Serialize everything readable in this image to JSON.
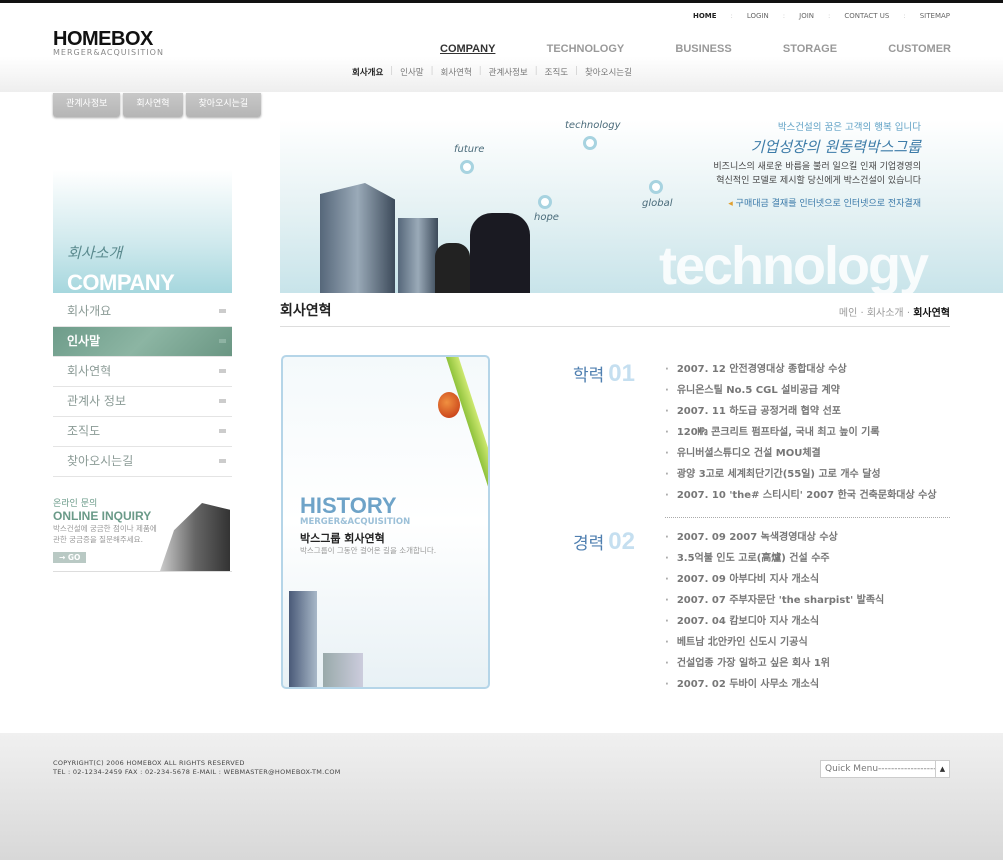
{
  "logo": {
    "title": "HOMEBOX",
    "subtitle": "MERGER&ACQUISITION"
  },
  "util_nav": [
    "HOME",
    "LOGIN",
    "JOIN",
    "CONTACT US",
    "SITEMAP"
  ],
  "main_nav": [
    "COMPANY",
    "TECHNOLOGY",
    "BUSINESS",
    "STORAGE",
    "CUSTOMER"
  ],
  "sub_nav": [
    "회사개요",
    "인사말",
    "회사연혁",
    "관계사정보",
    "조직도",
    "찾아오시는길"
  ],
  "tabs": [
    "관계사정보",
    "회사연혁",
    "찾아오시는길"
  ],
  "banner": {
    "nodes": [
      "future",
      "technology",
      "hope",
      "global"
    ],
    "line1": "박스건설의 꿈은 고객의 행복 입니다",
    "line2": "기업성장의 원동력박스그룹",
    "line3": "비즈니스의 새로운 바름을 불러 일으킬 인재 기업경영의",
    "line4": "혁신적인 모델로 제시할 당신에게 박스건설이 있습니다",
    "link": "구매대금 결재를 인터넷으로 인터넷으로 전자결재",
    "big_word": "technology"
  },
  "left_banner": {
    "korean": "회사소개",
    "english": "COMPANY"
  },
  "left_menu": [
    "회사개요",
    "인사말",
    "회사연혁",
    "관계사 정보",
    "조직도",
    "찾아오시는길"
  ],
  "active_menu_index": 1,
  "inquiry": {
    "korean": "온라인 문의",
    "english": "ONLINE INQUIRY",
    "desc1": "박스건설에 궁금한 점이나 제품에",
    "desc2": "관한 궁금증을 질문해주세요.",
    "go": "→ GO"
  },
  "page": {
    "title": "회사연혁",
    "breadcrumb": [
      "메인",
      "회사소개",
      "회사연혁"
    ]
  },
  "card": {
    "heading": "HISTORY",
    "sub": "MERGER&ACQUISITION",
    "title": "박스그룹 회사연혁",
    "desc": "박스그룹이 그동안 걸어온 길을 소개합니다."
  },
  "sections": [
    {
      "label": "학력",
      "number": "01",
      "items": [
        "2007. 12  안전경영대상 종합대상 수상",
        "유니온스틸 No.5 CGL 설비공급 계약",
        "2007. 11  하도급 공정거래 협약 선포",
        "120㎫ 콘크리트 펌프타설, 국내 최고 높이 기록",
        "유니버셜스튜디오 건설 MOU체결",
        "광양 3고로 세계최단기간(55일) 고로 개수 달성",
        "2007. 10  'the# 스티시티' 2007 한국 건축문화대상 수상"
      ]
    },
    {
      "label": "경력",
      "number": "02",
      "items": [
        "2007. 09 2007 녹색경영대상 수상",
        "3.5억불 인도 고로(高爐) 건설 수주",
        "2007. 09 아부다비 지사 개소식",
        "2007. 07 주부자문단 'the sharpist' 발족식",
        "2007. 04 캄보디아 지사 개소식",
        "베트남 北안카인 신도시 기공식",
        "건설업종 가장 일하고 싶은 회사 1위",
        "2007. 02 두바이 사무소 개소식"
      ]
    }
  ],
  "footer": {
    "copyright": "COPYRIGHT(C) 2006 HOMEBOX ALL RIGHTS RESERVED",
    "contact": "TEL : 02-1234-2459 FAX : 02-234-5678  E-MAIL : WEBMASTER@HOMEBOX-TM.COM",
    "quick_menu": "Quick Menu------------------"
  }
}
